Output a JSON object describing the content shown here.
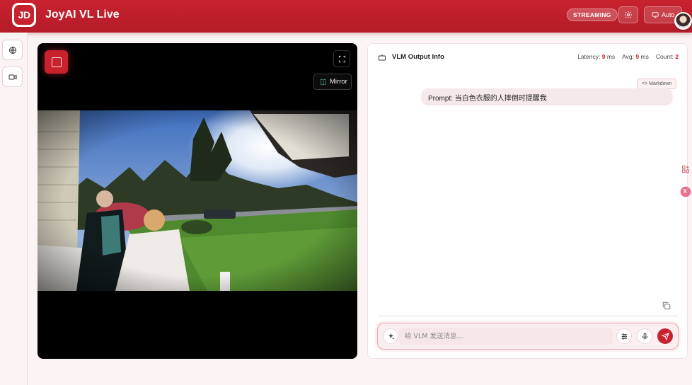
{
  "header": {
    "logo_text": "JD",
    "title": "JoyAI VL Live",
    "status_badge": "STREAMING",
    "theme_button_label": "Auto",
    "accent_color": "#c8222f"
  },
  "rail": {
    "items": [
      {
        "icon": "globe-icon"
      },
      {
        "icon": "video-camera-icon"
      }
    ]
  },
  "video": {
    "mirror_label": "Mirror",
    "stop_icon": "stop-square-icon",
    "fullscreen_icon": "fullscreen-icon"
  },
  "output": {
    "title": "VLM Output Info",
    "stats": {
      "latency_label": "Latency:",
      "latency_value": "9",
      "latency_unit": "ms",
      "avg_label": "Avg:",
      "avg_value": "9",
      "avg_unit": "ms",
      "count_label": "Count:",
      "count_value": "2"
    },
    "format_tag": "Markdown",
    "prompt_text": "Prompt: 当白色衣服的人摔倒时提醒我"
  },
  "composer": {
    "placeholder": "给 VLM 发送消息..."
  }
}
